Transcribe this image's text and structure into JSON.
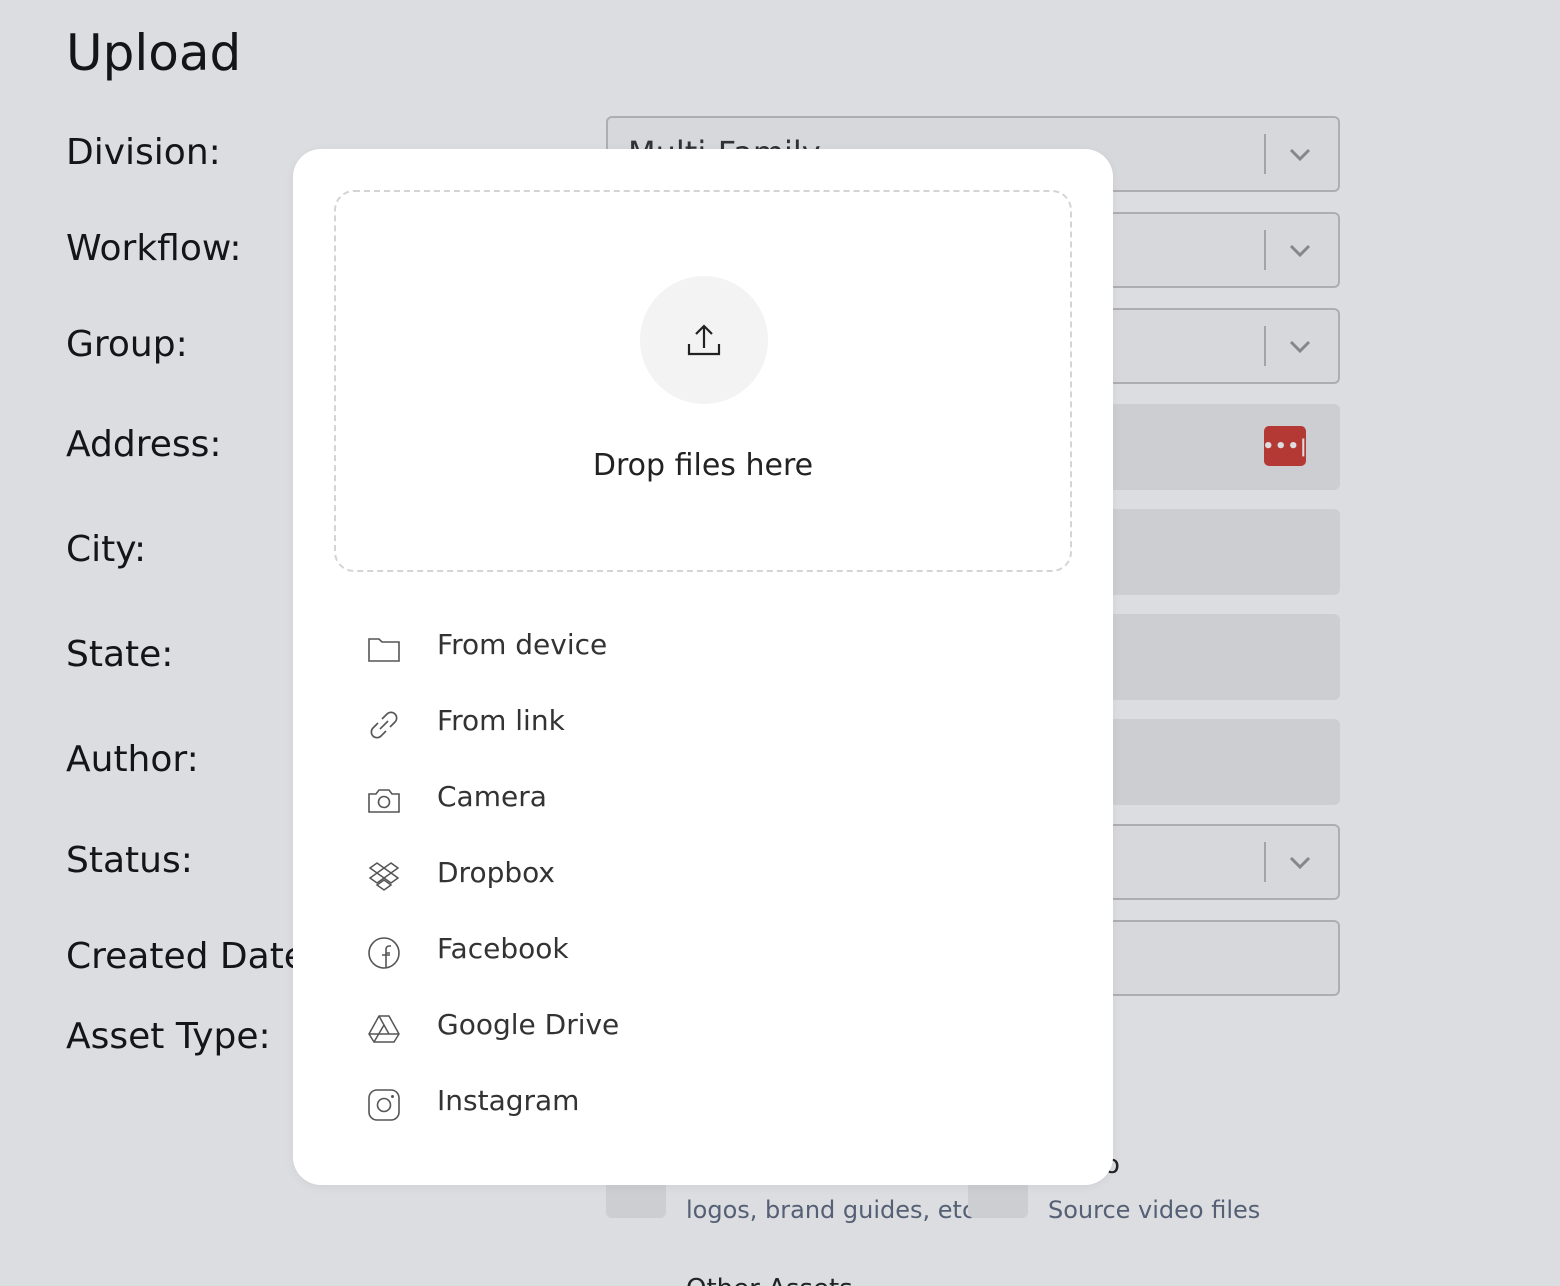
{
  "page": {
    "title": "Upload",
    "labels": {
      "division": "Division:",
      "workflow": "Workflow:",
      "group": "Group:",
      "address": "Address:",
      "city": "City:",
      "state": "State:",
      "author": "Author:",
      "status": "Status:",
      "created_date": "Created Date:",
      "asset_type": "Asset Type:"
    },
    "division_value": "Multi-Family",
    "address_badge": "•••|",
    "asset_types": [
      {
        "title": "",
        "desc": "logos, brand guides, etc"
      },
      {
        "title": "o",
        "desc": "Source video files"
      }
    ],
    "other_assets_partial": "Other Assets"
  },
  "modal": {
    "drop_text": "Drop files here",
    "sources": [
      {
        "label": "From device",
        "icon": "folder-icon"
      },
      {
        "label": "From link",
        "icon": "link-icon"
      },
      {
        "label": "Camera",
        "icon": "camera-icon"
      },
      {
        "label": "Dropbox",
        "icon": "dropbox-icon"
      },
      {
        "label": "Facebook",
        "icon": "facebook-icon"
      },
      {
        "label": "Google Drive",
        "icon": "google-drive-icon"
      },
      {
        "label": "Instagram",
        "icon": "instagram-icon"
      }
    ]
  },
  "colors": {
    "overlay": "#282c3c",
    "password_badge": "#d03c33",
    "muted_text": "#5f6b80"
  }
}
